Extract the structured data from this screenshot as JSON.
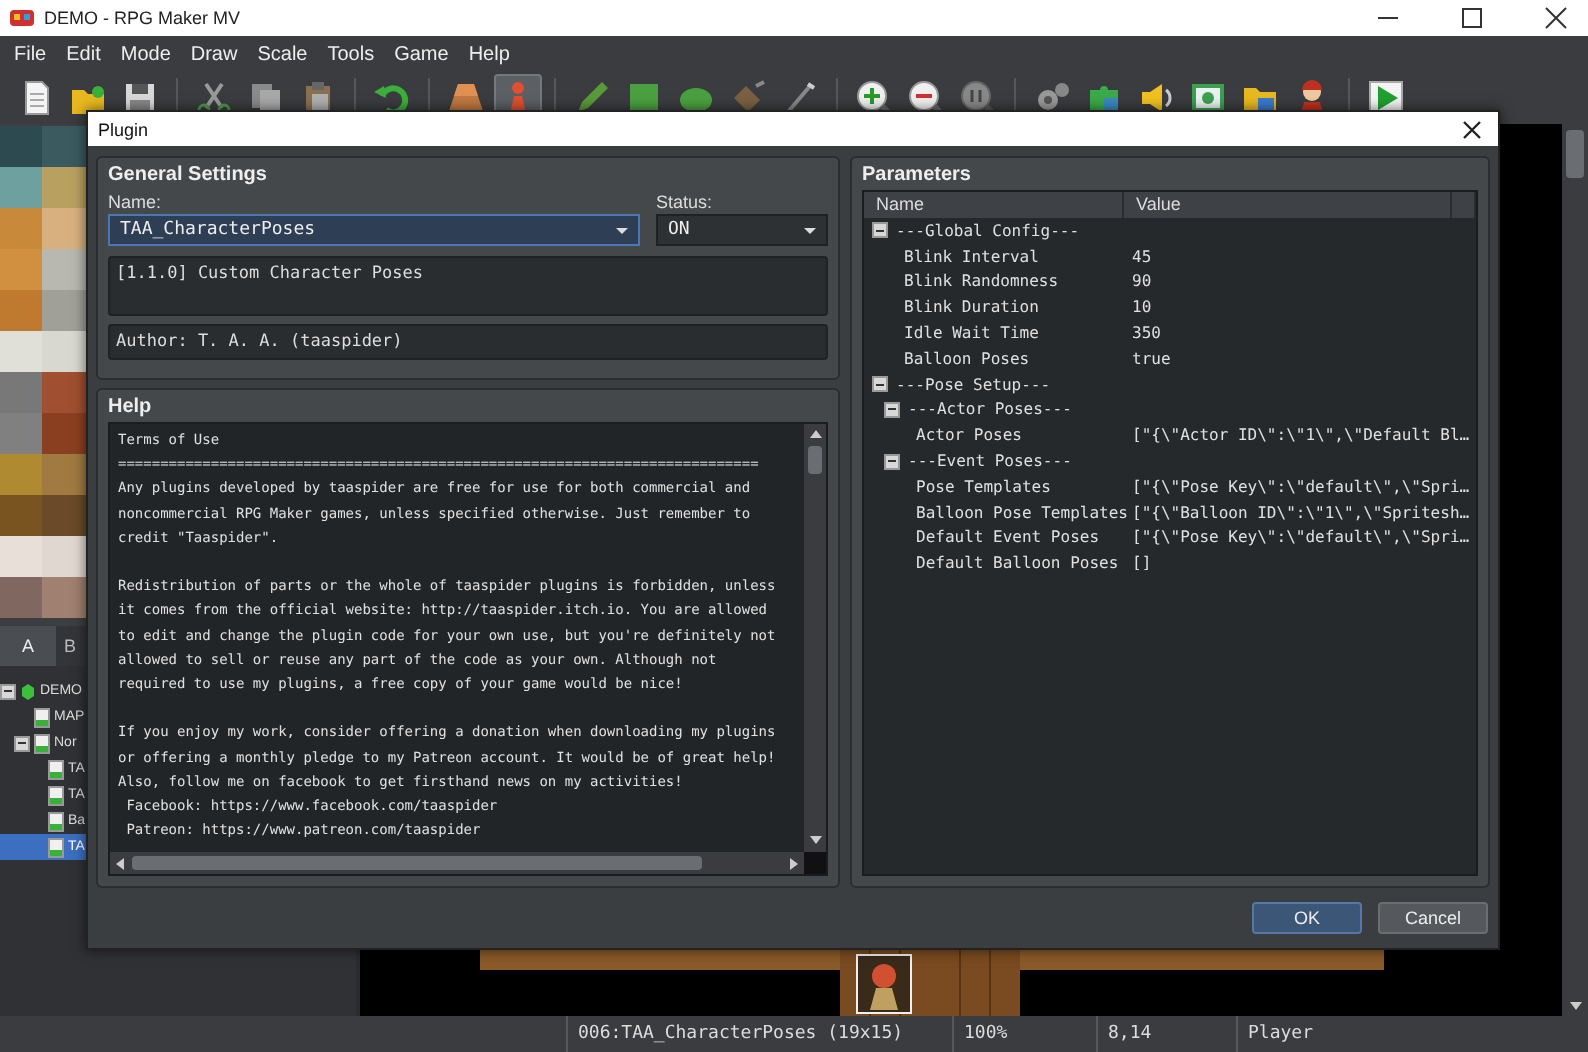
{
  "window": {
    "title": "DEMO - RPG Maker MV"
  },
  "menu": [
    "File",
    "Edit",
    "Mode",
    "Draw",
    "Scale",
    "Tools",
    "Game",
    "Help"
  ],
  "toolbar": [
    [
      {
        "kind": "new",
        "selected": false
      },
      {
        "kind": "open",
        "selected": false
      },
      {
        "kind": "save",
        "selected": false
      }
    ],
    [
      {
        "kind": "cut",
        "selected": false
      },
      {
        "kind": "copy",
        "selected": false
      },
      {
        "kind": "paste",
        "selected": false
      }
    ],
    [
      {
        "kind": "undo",
        "selected": false
      }
    ],
    [
      {
        "kind": "map",
        "selected": false
      },
      {
        "kind": "event",
        "selected": true
      }
    ],
    [
      {
        "kind": "pencil",
        "selected": false
      },
      {
        "kind": "rectangle",
        "selected": false
      },
      {
        "kind": "ellipse",
        "selected": false
      },
      {
        "kind": "fill",
        "selected": false
      },
      {
        "kind": "shadow",
        "selected": false
      }
    ],
    [
      {
        "kind": "zoomin",
        "selected": false
      },
      {
        "kind": "zoomout",
        "selected": false
      },
      {
        "kind": "zoomactual",
        "selected": false
      }
    ],
    [
      {
        "kind": "database",
        "selected": false
      },
      {
        "kind": "plugin",
        "selected": false
      },
      {
        "kind": "sound",
        "selected": false
      },
      {
        "kind": "resource",
        "selected": false
      },
      {
        "kind": "folder",
        "selected": false
      },
      {
        "kind": "character",
        "selected": false
      }
    ],
    [
      {
        "kind": "play",
        "selected": false
      }
    ]
  ],
  "tileset_tabs": [
    {
      "label": "A",
      "selected": true
    },
    {
      "label": "B",
      "selected": false
    }
  ],
  "map_tree": [
    {
      "label": "DEMO",
      "kind": "project",
      "expanded": true,
      "selected": false,
      "children": [
        {
          "label": "MAP",
          "kind": "map",
          "selected": false
        },
        {
          "label": "Nor",
          "kind": "map",
          "expanded": true,
          "selected": false,
          "children": [
            {
              "label": "TA",
              "kind": "map",
              "selected": false
            },
            {
              "label": "TA",
              "kind": "map",
              "selected": false
            },
            {
              "label": "Ba",
              "kind": "map",
              "selected": false
            },
            {
              "label": "TA",
              "kind": "map",
              "selected": true
            }
          ]
        }
      ]
    }
  ],
  "dialog": {
    "title": "Plugin",
    "general": {
      "heading": "General Settings",
      "name_label": "Name:",
      "name_value": "TAA_CharacterPoses",
      "status_label": "Status:",
      "status_value": "ON",
      "description": "[1.1.0] Custom Character Poses",
      "author": "Author: T. A. A. (taaspider)"
    },
    "help": {
      "heading": "Help",
      "text": "Terms of Use\n============================================================================\nAny plugins developed by taaspider are free for use for both commercial and\nnoncommercial RPG Maker games, unless specified otherwise. Just remember to\ncredit \"Taaspider\".\n\nRedistribution of parts or the whole of taaspider plugins is forbidden, unless\nit comes from the official website: http://taaspider.itch.io. You are allowed\nto edit and change the plugin code for your own use, but you're definitely not\nallowed to sell or reuse any part of the code as your own. Although not\nrequired to use my plugins, a free copy of your game would be nice!\n\nIf you enjoy my work, consider offering a donation when downloading my plugins\nor offering a monthly pledge to my Patreon account. It would be of great help!\nAlso, follow me on facebook to get firsthand news on my activities!\n Facebook: https://www.facebook.com/taaspider\n Patreon: https://www.patreon.com/taaspider"
    },
    "parameters": {
      "heading": "Parameters",
      "columns": [
        "Name",
        "Value"
      ],
      "rows": [
        {
          "name": "---Global Config---",
          "expanded": true,
          "children": [
            {
              "name": "Blink Interval",
              "value": "45"
            },
            {
              "name": "Blink Randomness",
              "value": "90"
            },
            {
              "name": "Blink Duration",
              "value": "10"
            },
            {
              "name": "Idle Wait Time",
              "value": "350"
            },
            {
              "name": "Balloon Poses",
              "value": "true"
            }
          ]
        },
        {
          "name": "---Pose Setup---",
          "expanded": true,
          "children": [
            {
              "name": "---Actor Poses---",
              "expanded": true,
              "children": [
                {
                  "name": "Actor Poses",
                  "value": "[\"{\\\"Actor ID\\\":\\\"1\\\",\\\"Default Bl…"
                }
              ]
            },
            {
              "name": "---Event Poses---",
              "expanded": true,
              "children": [
                {
                  "name": "Pose Templates",
                  "value": "[\"{\\\"Pose Key\\\":\\\"default\\\",\\\"Spri…"
                },
                {
                  "name": "Balloon Pose Templates",
                  "value": "[\"{\\\"Balloon ID\\\":\\\"1\\\",\\\"Spritesh…"
                },
                {
                  "name": "Default Event Poses",
                  "value": "[\"{\\\"Pose Key\\\":\\\"default\\\",\\\"Spri…"
                },
                {
                  "name": "Default Balloon Poses",
                  "value": "[]"
                }
              ]
            }
          ]
        }
      ]
    },
    "buttons": [
      {
        "label": "OK",
        "kind": "default"
      },
      {
        "label": "Cancel",
        "kind": "normal"
      }
    ]
  },
  "status_bar": [
    "006:TAA_CharacterPoses (19x15)",
    "100%",
    "8,14",
    "Player"
  ]
}
